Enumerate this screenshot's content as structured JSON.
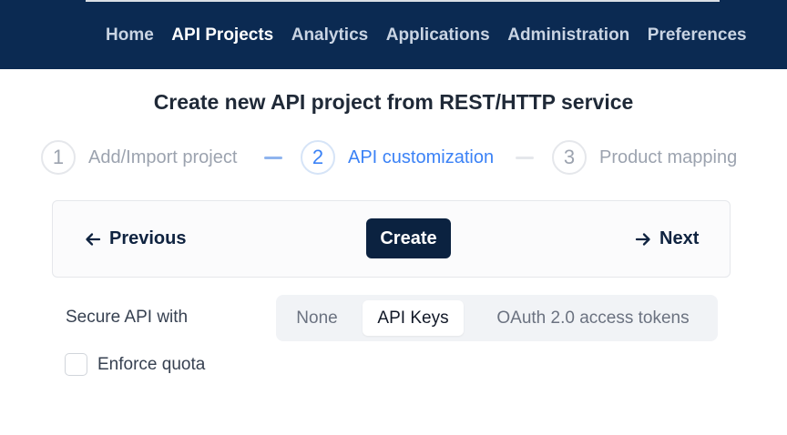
{
  "nav": {
    "items": [
      {
        "label": "Home",
        "active": false
      },
      {
        "label": "API Projects",
        "active": true
      },
      {
        "label": "Analytics",
        "active": false
      },
      {
        "label": "Applications",
        "active": false
      },
      {
        "label": "Administration",
        "active": false
      },
      {
        "label": "Preferences",
        "active": false
      }
    ]
  },
  "page": {
    "title": "Create new API project from REST/HTTP service"
  },
  "stepper": {
    "steps": [
      {
        "number": "1",
        "label": "Add/Import project",
        "state": "done"
      },
      {
        "number": "2",
        "label": "API customization",
        "state": "current"
      },
      {
        "number": "3",
        "label": "Product mapping",
        "state": "upcoming"
      }
    ]
  },
  "actions": {
    "previous_label": "Previous",
    "create_label": "Create",
    "next_label": "Next"
  },
  "security": {
    "label": "Secure API with",
    "options": [
      "None",
      "API Keys",
      "OAuth 2.0 access tokens"
    ],
    "selected": "API Keys"
  },
  "quota": {
    "label": "Enforce quota",
    "checked": false
  },
  "colors": {
    "topbar": "#0b2a52",
    "accent": "#3b82f6",
    "primary_button": "#0b2240"
  }
}
